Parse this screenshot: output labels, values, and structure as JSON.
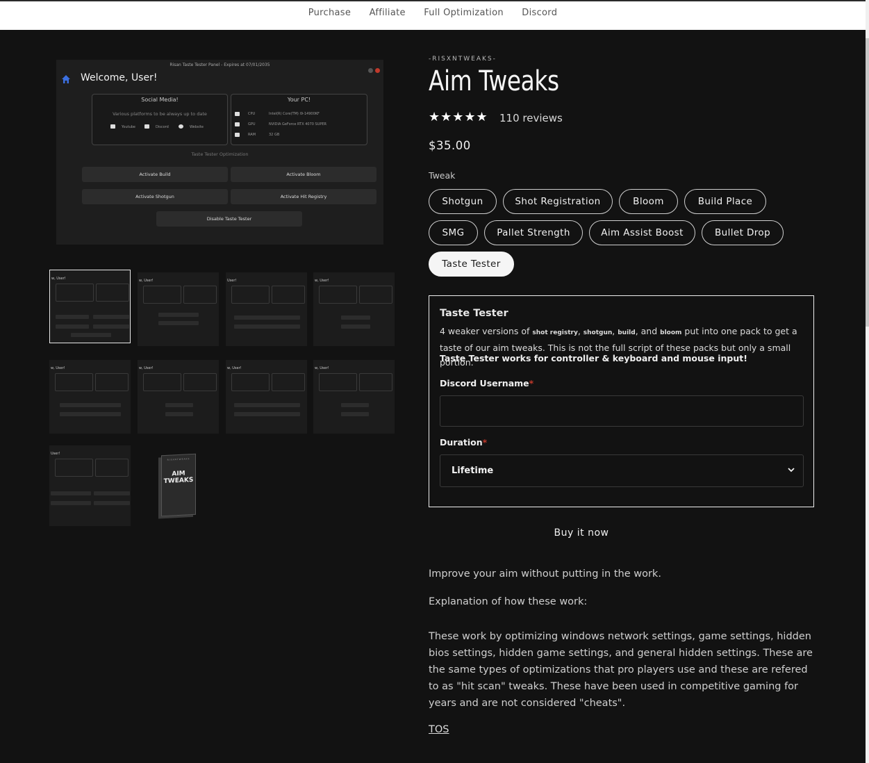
{
  "nav": {
    "items": [
      "Purchase",
      "Affiliate",
      "Full Optimization",
      "Discord"
    ]
  },
  "panel": {
    "titlebar": "Risan Taste Tester Panel - Expires at 07/01/2035",
    "welcome": "Welcome, User!",
    "social_title": "Social Media!",
    "social_sub": "Various platforms to be always up to date",
    "social_links": [
      "Youtube",
      "Discord",
      "Website"
    ],
    "pc_title": "Your PC!",
    "pc_rows": [
      {
        "k": "CPU",
        "v": "Intel(R) Core(TM) i9-14900KF"
      },
      {
        "k": "GPU",
        "v": "NVIDIA GeForce RTX 4070 SUPER"
      },
      {
        "k": "RAM",
        "v": "32 GB"
      }
    ],
    "section": "Taste Tester Optimization",
    "buttons": [
      "Activate Build",
      "Activate Bloom",
      "Activate Shotgun",
      "Activate Hit Registry"
    ],
    "disable": "Disable Taste Tester"
  },
  "thumb": {
    "label": "User!",
    "label2": "w, User!"
  },
  "boxart": {
    "brand": "RISXNTWEAKS",
    "title_line1": "AIM",
    "title_line2": "TWEAKS"
  },
  "product": {
    "vendor": "-RISXNTWEAKS-",
    "title": "Aim Tweaks",
    "stars": "★★★★★",
    "rating": 5,
    "reviews": "110 reviews",
    "price": "$35.00",
    "tweak_label": "Tweak",
    "variants": [
      "Shotgun",
      "Shot Registration",
      "Bloom",
      "Build Place",
      "SMG",
      "Pallet Strength",
      "Aim Assist Boost",
      "Bullet Drop",
      "Taste Tester"
    ],
    "selected_variant": "Taste Tester"
  },
  "form": {
    "title": "Taste Tester",
    "desc_a": "4 weaker versions of ",
    "desc_b": "shot registry",
    "desc_c": ", ",
    "desc_d": "shotgun",
    "desc_e": ", ",
    "desc_f": "build",
    "desc_g": ", and ",
    "desc_h": "bloom",
    "desc_i": " put into one pack to get a taste of our aim tweaks. This is not the full script of these packs but only a small portion.",
    "bold_line": "Taste Tester works for controller & keyboard and mouse input!",
    "discord_label": "Discord Username",
    "discord_value": "",
    "duration_label": "Duration",
    "duration_value": "Lifetime",
    "required_mark": "*"
  },
  "buy_label": "Buy it now",
  "description": {
    "p1": "Improve your aim without putting in the work.",
    "p2": "Explanation of how these work:",
    "p3": "These work by optimizing windows network settings, game settings, hidden bios settings, hidden game settings, and general hidden settings. These are the same types of optimizations that pro players use and these are refered to as \"hit scan\" tweaks. These have been used in competitive gaming for years and are not considered \"cheats\".",
    "tos": "TOS"
  },
  "colors": {
    "background": "#121212",
    "accent": "#f5f5f5",
    "required": "#c0392b",
    "home_icon": "#3b6fe0"
  }
}
